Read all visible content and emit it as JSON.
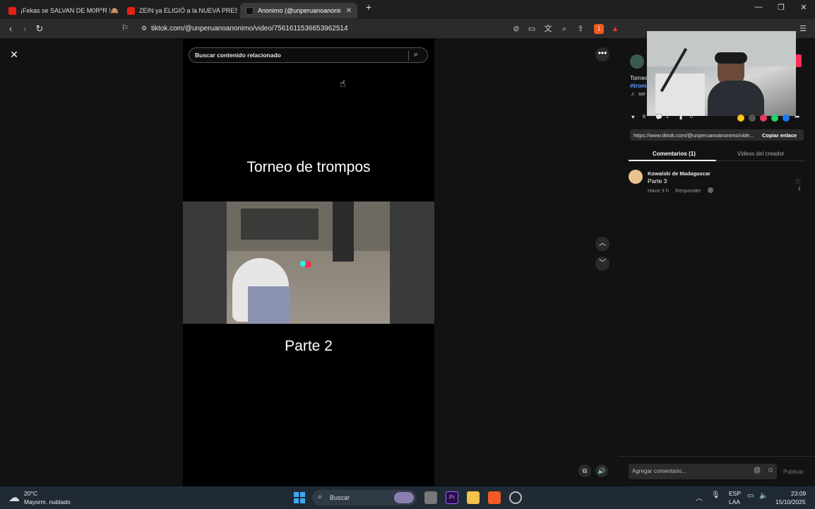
{
  "browser": {
    "tabs": [
      {
        "label": "¡Fekas se SALVAN DE M0R*R !🙈",
        "icon": "youtube-icon"
      },
      {
        "label": "ZEIN ya ELIGIÓ a la NUEVA PRESIDEN",
        "icon": "youtube-icon"
      },
      {
        "label": "Anonimo (@unperuanoanonimo",
        "icon": "tiktok-icon"
      }
    ],
    "url": "tiktok.com/@unperuanoanonimo/video/7561611536653962514",
    "shield_count": "1"
  },
  "video": {
    "search_placeholder": "Buscar contenido relacionado",
    "title_top": "Torneo de trompos",
    "title_bottom": "Parte 2"
  },
  "side": {
    "desc_line1": "Tornec",
    "desc_hashtag": "#trom",
    "desc_sound": "sor",
    "stats": {
      "likes": "8",
      "comments": "1",
      "saves": "0"
    },
    "link_url": "https://www.tiktok.com/@unperuanoanonimo/vide...",
    "copy_label": "Copiar enlace",
    "tab_comments": "Comentarios (1)",
    "tab_creator": "Videos del creador",
    "comment": {
      "user": "Kowalski de Madagascar",
      "text": "Parte 3",
      "time": "Hace 3 h",
      "reply": "Responder",
      "likes": "1"
    },
    "input_placeholder": "Agregar comentario...",
    "publish_label": "Publicar"
  },
  "taskbar": {
    "weather_temp": "20°C",
    "weather_desc": "Mayorm. nublado",
    "search_label": "Buscar",
    "lang1": "ESP",
    "lang2": "LAA",
    "time": "23:09",
    "date": "15/10/2025"
  },
  "colors": {
    "accent": "#fe2c55",
    "taskbar": "#202a35"
  }
}
